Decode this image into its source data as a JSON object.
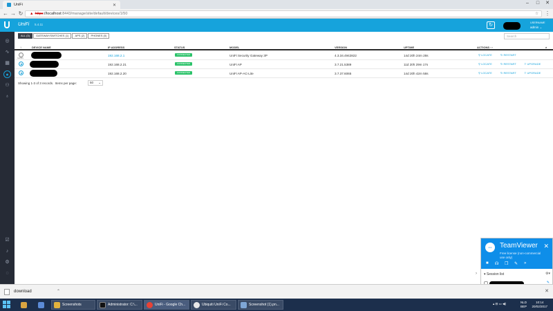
{
  "browser": {
    "tab_title": "UniFi",
    "url_warning": "▲",
    "url_scheme": "https",
    "url_host": "://localhost",
    "url_path": ":8443/manage/site/default/devices/1/50"
  },
  "header": {
    "brand": "UniFi",
    "version": "5.4.11",
    "user_label": "USERNAME",
    "user_name": "admin"
  },
  "filters": {
    "buttons": [
      "ALL (3)",
      "GATEWAY/SWITCHES (1)",
      "APS (2)",
      "PHONES (0)"
    ],
    "search_placeholder": "Search"
  },
  "table": {
    "headers": {
      "sort": "↑",
      "device_name": "DEVICE NAME",
      "ip": "IP ADDRESS",
      "status": "STATUS",
      "model": "MODEL",
      "version": "VERSION",
      "uptime": "UPTIME",
      "actions": "ACTIONS"
    },
    "rows": [
      {
        "ip": "192.168.2.1",
        "status": "CONNECTED",
        "model": "UniFi Security Gateway 3P",
        "version": "4.3.34.4942822",
        "uptime": "14d 20h 24m 28s",
        "locate": "LOCATE",
        "restart": "RESTART",
        "upgrade": "",
        "icon_label": "GW/MS"
      },
      {
        "ip": "192.168.2.21",
        "status": "CONNECTED",
        "model": "UniFi AP",
        "version": "3.7.21.5389",
        "uptime": "11d 20h 29m 17s",
        "locate": "LOCATE",
        "restart": "RESTART",
        "upgrade": "UPGRADE"
      },
      {
        "ip": "192.168.2.20",
        "status": "CONNECTED",
        "model": "UniFi AP-AC-Lite",
        "version": "3.7.37.6065",
        "uptime": "14d 20h 42m 58s",
        "locate": "LOCATE",
        "restart": "RESTART",
        "upgrade": "UPGRADE"
      }
    ],
    "footer": "Showing 1-3 of 3 records.",
    "per_page_label": "Items per page:",
    "per_page_value": "50"
  },
  "teamviewer": {
    "title": "TeamViewer",
    "subtitle": "Free license (non-commercial use only)",
    "session_list": "Session list",
    "link": "www.teamviewer.com"
  },
  "downloads": {
    "file": "download"
  },
  "taskbar": {
    "items": [
      "Screenshots",
      "Administrator: C:\\...",
      "UniFi - Google Ch...",
      "Ubiquiti UniFi Co...",
      "Screenshot (1).pn..."
    ],
    "lang": "NLD",
    "layout": "BEP",
    "time": "10:14",
    "date": "20/02/2017"
  },
  "colors": {
    "accent": "#16a3dc",
    "connected": "#2cc36a",
    "sidebar": "#262b36",
    "taskbar": "#1c2f4c"
  }
}
